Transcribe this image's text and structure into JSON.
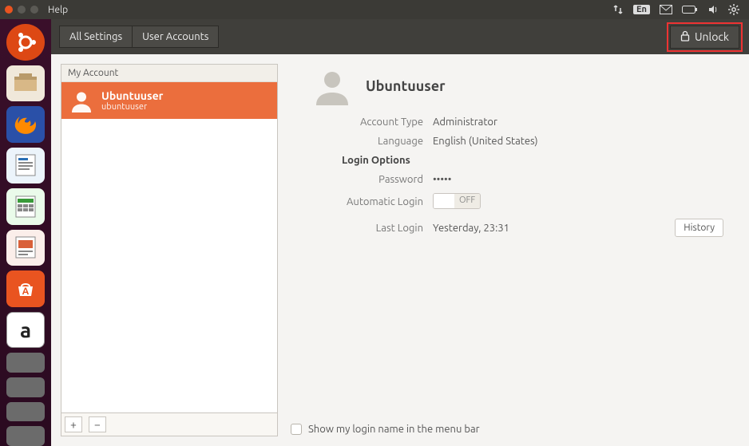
{
  "topbar": {
    "title": "Help",
    "language_indicator": "En"
  },
  "toolbar": {
    "crumb_all_settings": "All Settings",
    "crumb_user_accounts": "User Accounts",
    "unlock_label": "Unlock"
  },
  "sidebar": {
    "section_label": "My Account",
    "selected_user": {
      "display_name": "Ubuntuuser",
      "username": "ubuntuuser"
    },
    "add_label": "+",
    "remove_label": "−"
  },
  "detail": {
    "display_name": "Ubuntuuser",
    "account_type_label": "Account Type",
    "account_type_value": "Administrator",
    "language_label": "Language",
    "language_value": "English (United States)",
    "login_options_title": "Login Options",
    "password_label": "Password",
    "password_value": "•••••",
    "auto_login_label": "Automatic Login",
    "auto_login_state": "OFF",
    "last_login_label": "Last Login",
    "last_login_value": "Yesterday, 23:31",
    "history_label": "History"
  },
  "footer": {
    "show_name_label": "Show my login name in the menu bar"
  },
  "launcher_items": [
    "ubuntu-dash",
    "files",
    "firefox",
    "writer",
    "calc",
    "impress",
    "software-center",
    "amazon"
  ]
}
